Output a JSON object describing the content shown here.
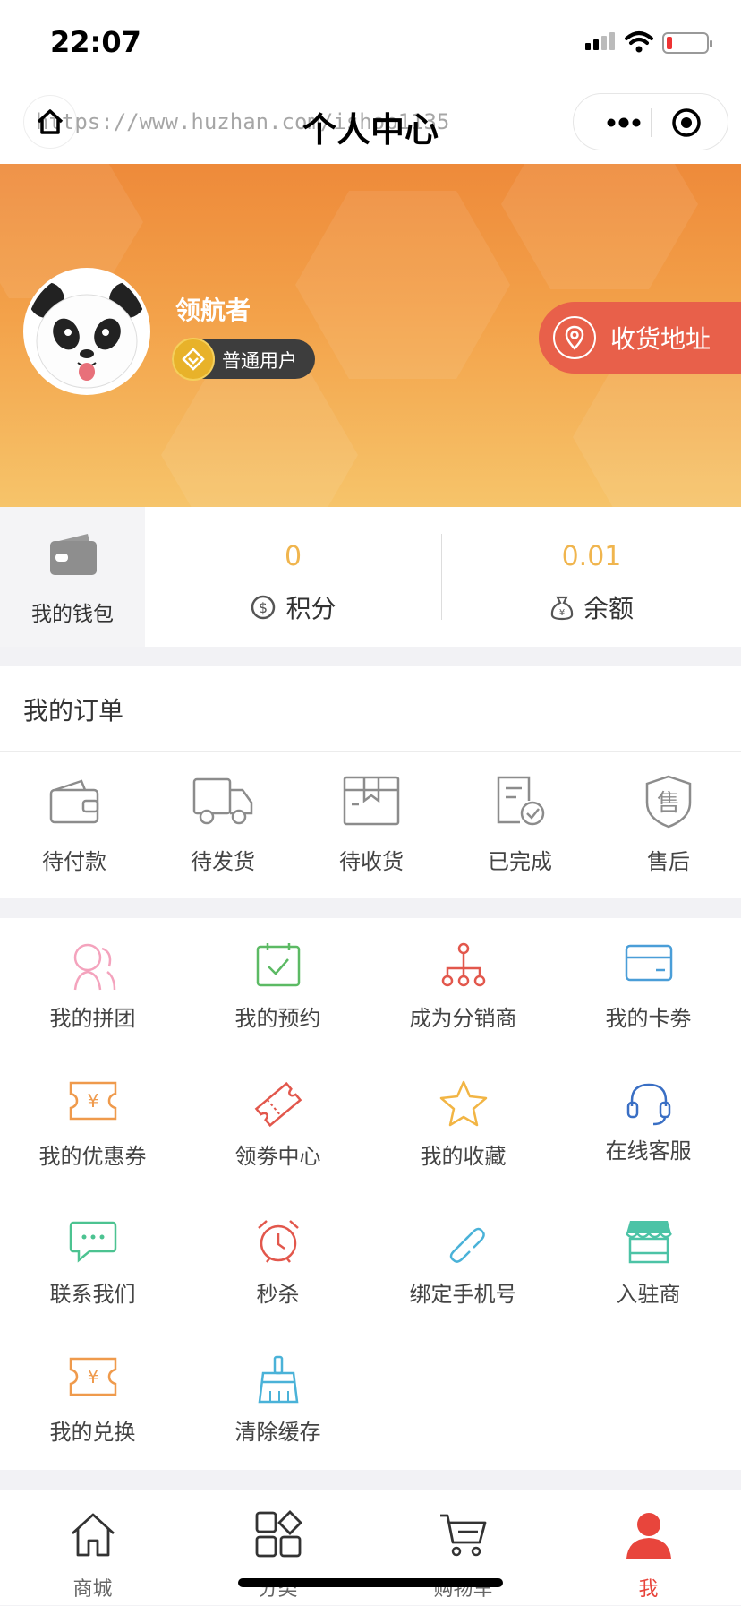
{
  "status": {
    "time": "22:07"
  },
  "nav": {
    "title": "个人中心",
    "watermark": "https://www.huzhan.com/ishop1135"
  },
  "profile": {
    "username": "领航者",
    "level": "普通用户",
    "address_button": "收货地址"
  },
  "wallet": {
    "label": "我的钱包",
    "points_value": "0",
    "points_label": "积分",
    "balance_value": "0.01",
    "balance_label": "余额"
  },
  "orders": {
    "title": "我的订单",
    "items": [
      {
        "label": "待付款",
        "icon": "wallet-icon"
      },
      {
        "label": "待发货",
        "icon": "truck-icon"
      },
      {
        "label": "待收货",
        "icon": "package-icon"
      },
      {
        "label": "已完成",
        "icon": "completed-icon"
      },
      {
        "label": "售后",
        "icon": "shield-icon"
      }
    ]
  },
  "services": [
    {
      "label": "我的拼团",
      "icon": "group-icon",
      "color": "#f4a3bd"
    },
    {
      "label": "我的预约",
      "icon": "calendar-check-icon",
      "color": "#5cba64"
    },
    {
      "label": "成为分销商",
      "icon": "distribution-icon",
      "color": "#e2574c"
    },
    {
      "label": "我的卡劵",
      "icon": "card-icon",
      "color": "#4a9ed8"
    },
    {
      "label": "我的优惠券",
      "icon": "coupon-icon",
      "color": "#ef9a4c"
    },
    {
      "label": "领劵中心",
      "icon": "ticket-icon",
      "color": "#e2574c"
    },
    {
      "label": "我的收藏",
      "icon": "star-icon",
      "color": "#f2b544"
    },
    {
      "label": "在线客服",
      "icon": "headset-icon",
      "color": "#3a6fc4"
    },
    {
      "label": "联系我们",
      "icon": "chat-icon",
      "color": "#4cc391"
    },
    {
      "label": "秒杀",
      "icon": "alarm-icon",
      "color": "#e2574c"
    },
    {
      "label": "绑定手机号",
      "icon": "link-icon",
      "color": "#4ab2d8"
    },
    {
      "label": "入驻商",
      "icon": "store-icon",
      "color": "#4cc3a6"
    },
    {
      "label": "我的兑换",
      "icon": "exchange-icon",
      "color": "#ef9a4c"
    },
    {
      "label": "清除缓存",
      "icon": "broom-icon",
      "color": "#4ab2d8"
    }
  ],
  "tabs": [
    {
      "label": "商城",
      "icon": "home-icon"
    },
    {
      "label": "分类",
      "icon": "category-icon"
    },
    {
      "label": "购物车",
      "icon": "cart-icon"
    },
    {
      "label": "我",
      "icon": "user-icon",
      "active": true,
      "color": "#e8453c"
    }
  ],
  "colors": {
    "accent": "#e8453c",
    "hero_start": "#ee8a3a",
    "hero_end": "#f6c46a",
    "value": "#f0b54e"
  }
}
